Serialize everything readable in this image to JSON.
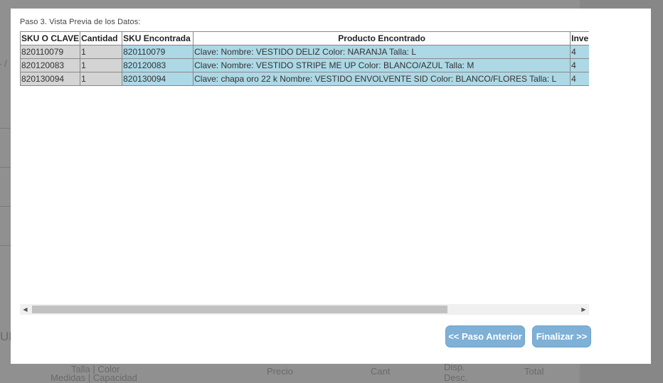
{
  "modal": {
    "step_title": "Paso 3. Vista Previa de los Datos:",
    "buttons": {
      "previous": "<< Paso Anterior",
      "finish": "Finalizar >>"
    }
  },
  "table": {
    "headers": [
      "SKU O CLAVE",
      "Cantidad",
      "SKU Encontrada",
      "Producto Encontrado",
      "Inventario"
    ],
    "rows": [
      [
        "820110079",
        "1",
        "820110079",
        "Clave: Nombre: VESTIDO DELIZ Color: NARANJA Talla: L",
        "4"
      ],
      [
        "820120083",
        "1",
        "820120083",
        "Clave: Nombre: VESTIDO STRIPE ME UP Color: BLANCO/AZUL Talla: M",
        "4"
      ],
      [
        "820130094",
        "1",
        "820130094",
        "Clave: chapa oro 22 k Nombre: VESTIDO ENVOLVENTE SID Color: BLANCO/FLORES Talla: L",
        "4"
      ]
    ]
  },
  "background": {
    "footer_labels": [
      "Talla | Color",
      "Medidas | Capacidad",
      "Precio",
      "Cant",
      "Disp.",
      "Desc.",
      "Total"
    ],
    "side_letters": [
      "UR",
      "- /"
    ]
  },
  "colors": {
    "button": "#7fb0d6",
    "row_grey": "#d4d4d4",
    "row_blue": "#add8e6",
    "overlay": "#8c8c8c"
  },
  "icons": {
    "scroll_left": "triangle-left-icon",
    "scroll_right": "triangle-right-icon"
  }
}
